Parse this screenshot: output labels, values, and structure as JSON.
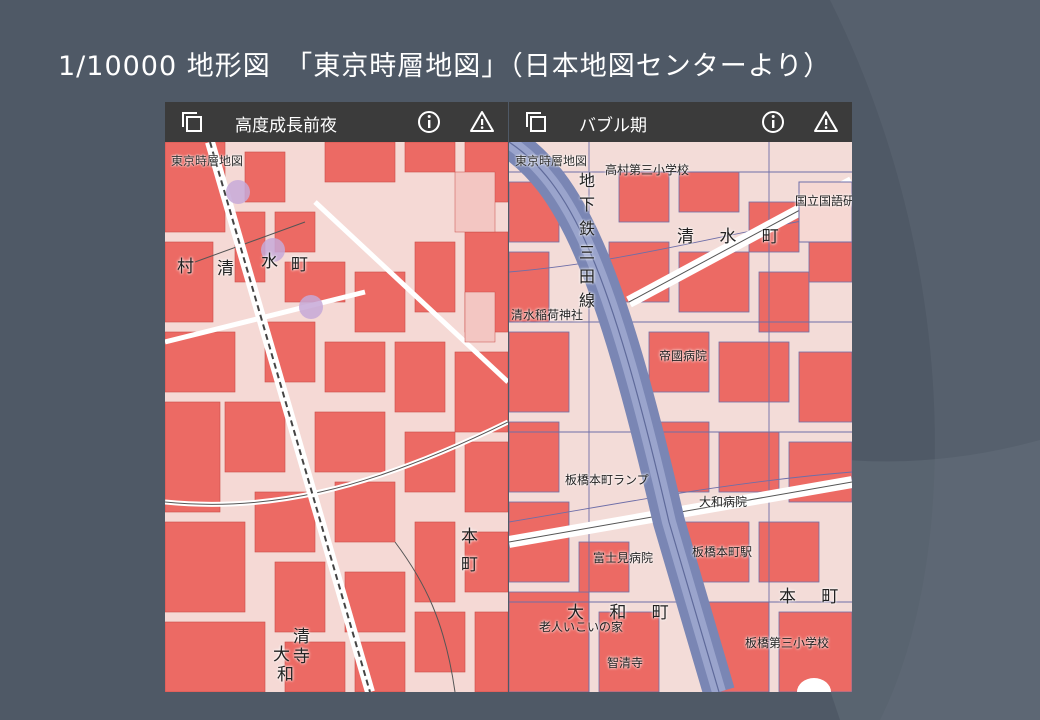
{
  "slide": {
    "title": "1/10000 地形図　「東京時層地図」（日本地図センターより）"
  },
  "colors": {
    "slide_background": "#4f5966",
    "header_background": "#3b3b3b",
    "map_red": "#ec6a64",
    "map_line": "#6e6ea8",
    "railway": "#7a86b4"
  },
  "panels": [
    {
      "title": "高度成長前夜",
      "map_source": "東京時層地図",
      "icons": [
        "layers-icon",
        "info-icon",
        "warning-icon"
      ],
      "labels": [
        "村",
        "清",
        "水",
        "町",
        "本",
        "町",
        "大",
        "清",
        "寺",
        "和"
      ]
    },
    {
      "title": "バブル期",
      "map_source": "東京時層地図",
      "icons": [
        "layers-icon",
        "info-icon",
        "warning-icon"
      ],
      "labels": [
        "高村第三小学校",
        "国立国語研",
        "清 水 町",
        "地下鉄三田線",
        "清水稲荷神社",
        "帝國病院",
        "板橋本町ランプ",
        "大和病院",
        "富士見病院",
        "板橋本町駅",
        "本 町",
        "大 和 町",
        "老人いこいの家",
        "板橋第三小学校",
        "智清寺"
      ]
    }
  ]
}
